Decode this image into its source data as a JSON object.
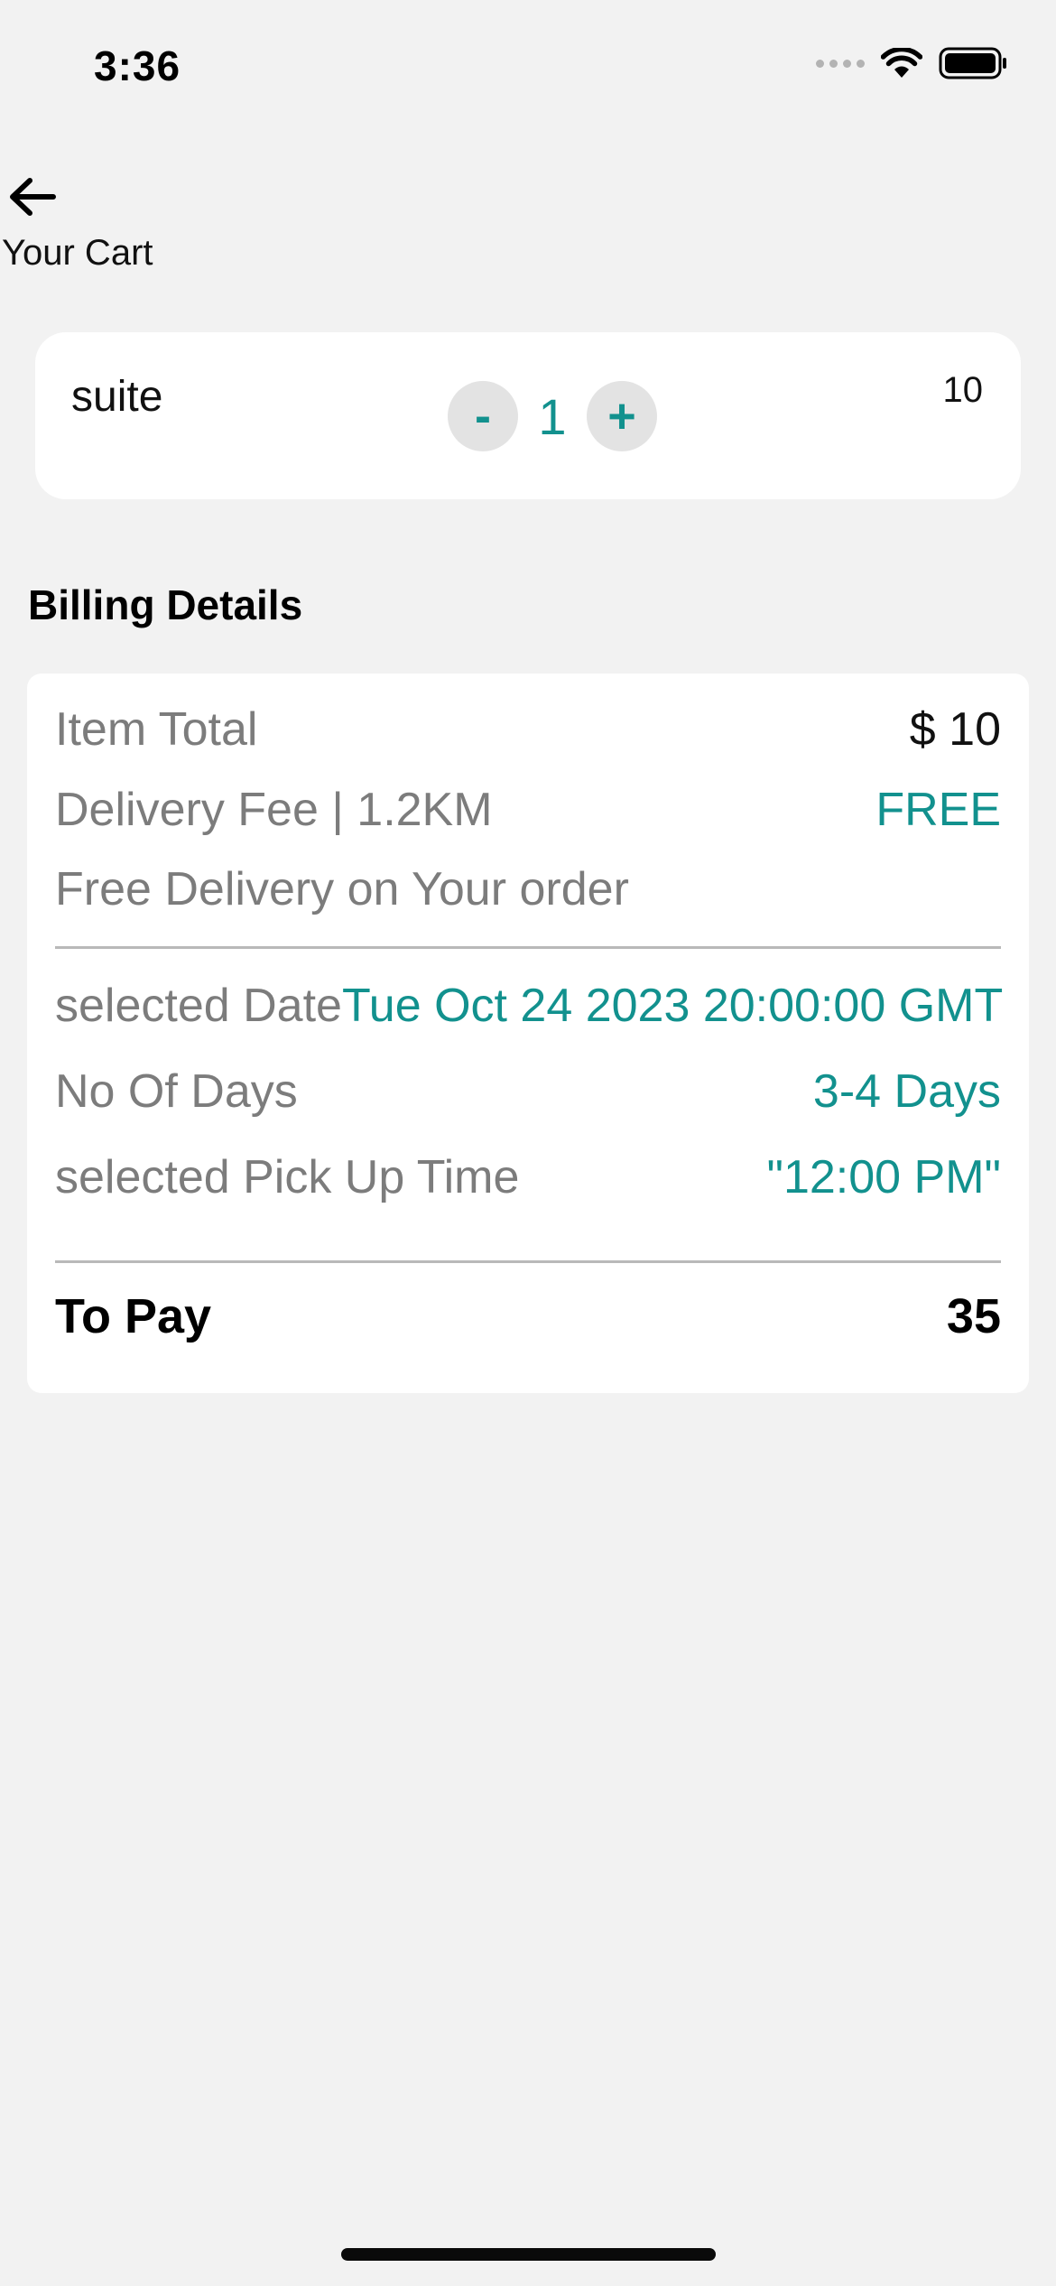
{
  "status_bar": {
    "time": "3:36",
    "icons": [
      "cellular-signal-icon",
      "wifi-icon",
      "battery-icon"
    ]
  },
  "header": {
    "back_icon": "arrow-left-icon",
    "title": "Your Cart"
  },
  "cart": {
    "items": [
      {
        "name": "suite",
        "quantity": "1",
        "decrement_label": "-",
        "increment_label": "+",
        "price": "10"
      }
    ]
  },
  "billing": {
    "heading": "Billing Details",
    "item_total_label": "Item Total",
    "item_total_value": "$ 10",
    "delivery_fee_label": "Delivery Fee | 1.2KM",
    "delivery_fee_value": "FREE",
    "free_delivery_note": "Free Delivery on Your order",
    "selected_date_label": "selected Date",
    "selected_date_value": "Tue Oct 24 2023 20:00:00 GMT",
    "no_of_days_label": "No Of Days",
    "no_of_days_value": "3-4 Days",
    "pickup_time_label": "selected Pick Up Time",
    "pickup_time_value": "\"12:00 PM\"",
    "to_pay_label": "To Pay",
    "to_pay_value": "35"
  },
  "colors": {
    "background": "#f2f2f2",
    "card": "#ffffff",
    "accent_teal": "#12918e",
    "label_gray": "#7c7c7c",
    "stepper_bg": "#e3e3e3"
  }
}
